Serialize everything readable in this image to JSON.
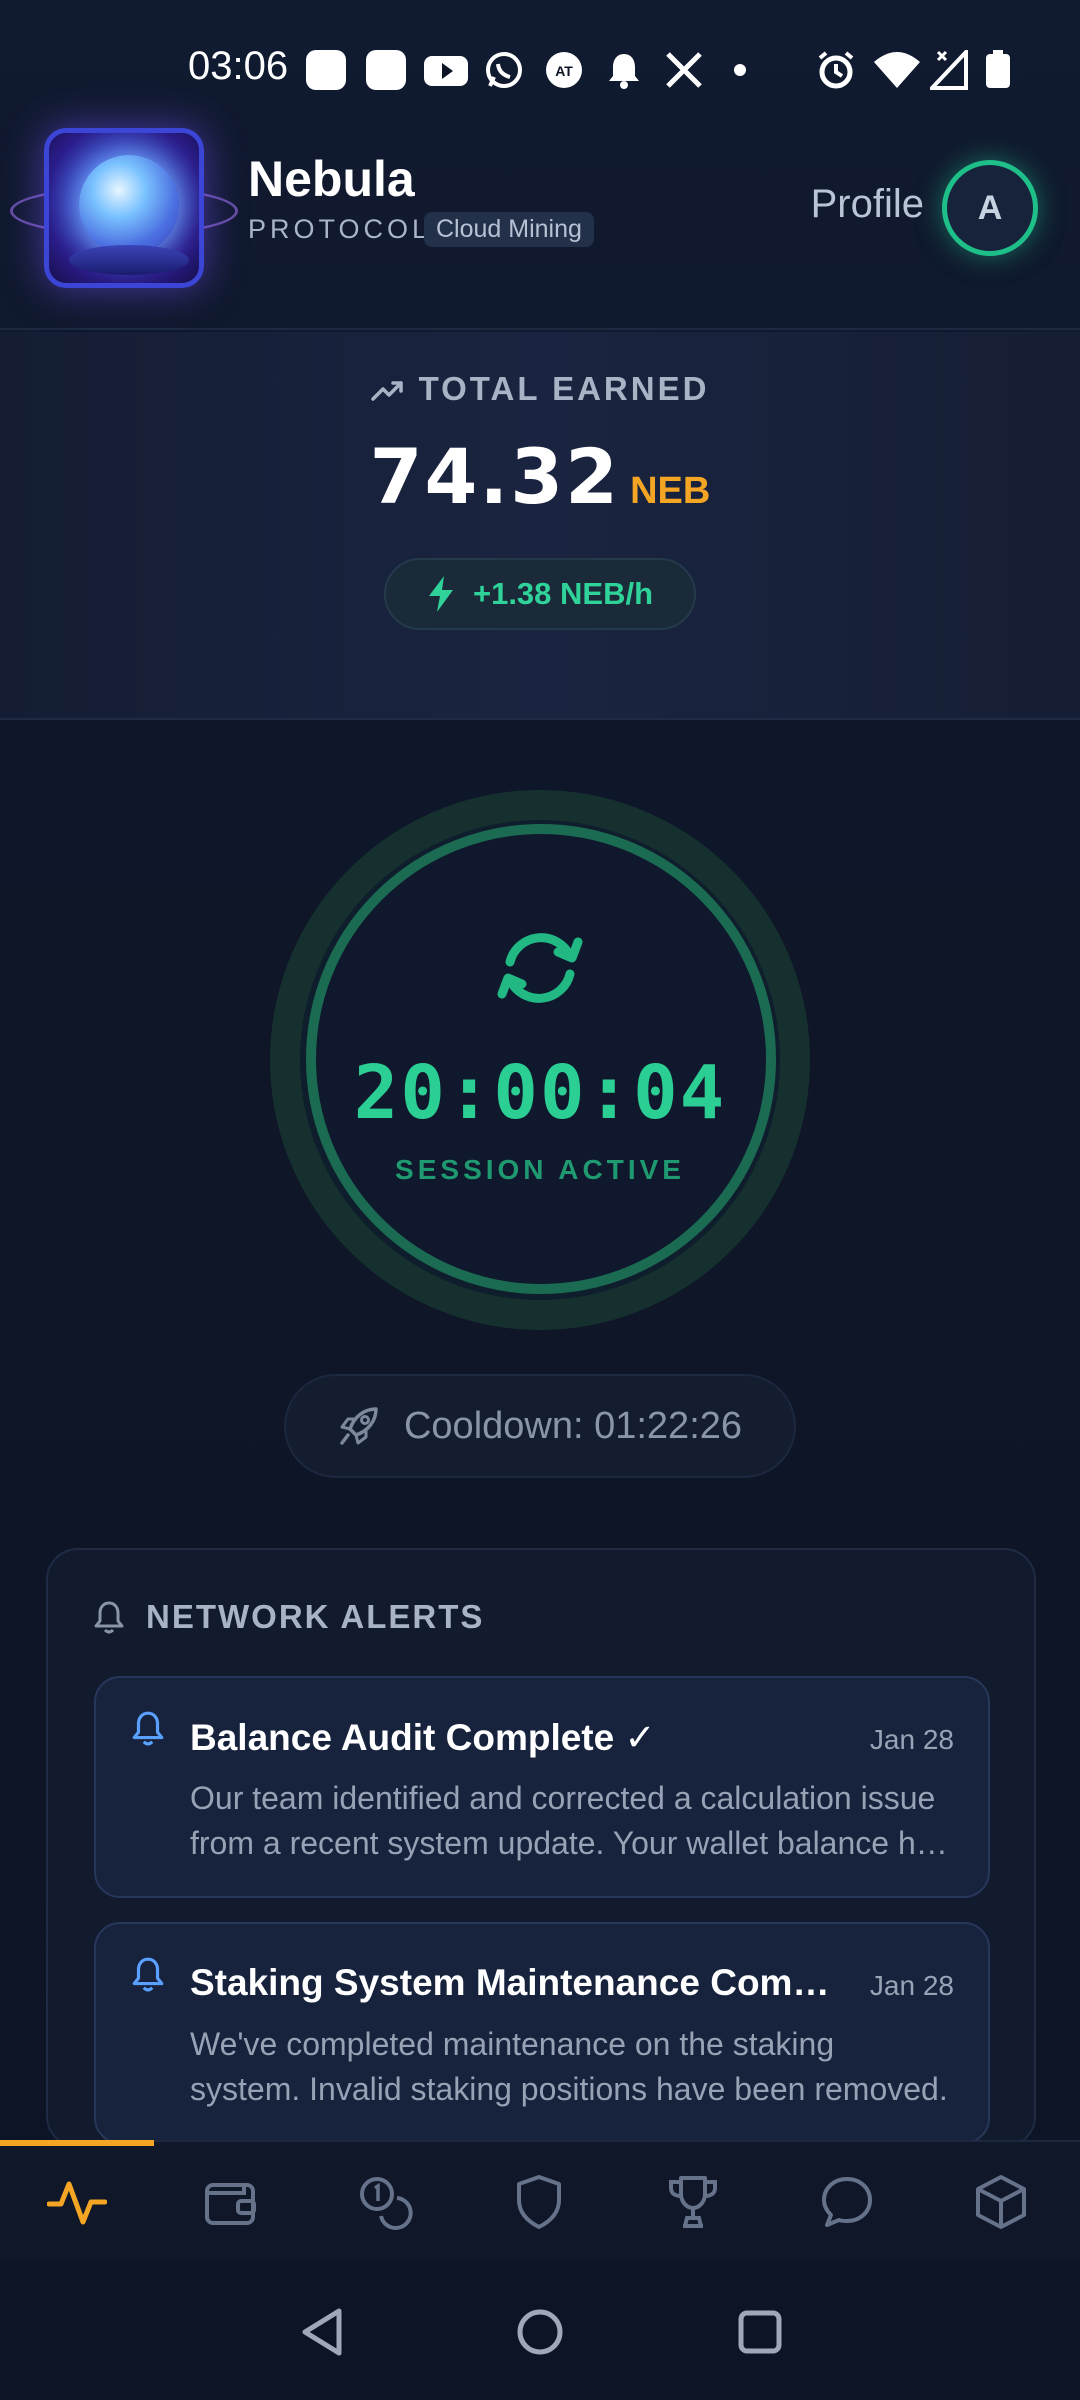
{
  "status_bar": {
    "time": "03:06",
    "icons": [
      "app-icon",
      "app-icon",
      "youtube-icon",
      "whatsapp-icon",
      "app-icon",
      "bell-icon",
      "x-icon",
      "dot-icon",
      "alarm-icon",
      "wifi-icon",
      "signal-icon",
      "battery-icon"
    ]
  },
  "header": {
    "brand_name": "Nebula",
    "brand_sub": "PROTOCOL",
    "brand_tag": "Cloud Mining",
    "profile_label": "Profile",
    "avatar_initial": "A"
  },
  "earned": {
    "title": "TOTAL EARNED",
    "value": "74.32",
    "unit": "NEB",
    "rate": "+1.38 NEB/h"
  },
  "session": {
    "time": "20:00:04",
    "label": "SESSION ACTIVE"
  },
  "cooldown": {
    "text": "Cooldown: 01:22:26"
  },
  "alerts": {
    "title": "NETWORK ALERTS",
    "items": [
      {
        "title": "Balance Audit Complete ✓",
        "date": "Jan 28",
        "body": "Our team identified and corrected a calculation issue from a recent system update. Your wallet balance has been restored."
      },
      {
        "title": "Staking System Maintenance Completed",
        "date": "Jan 28",
        "body": "We've completed maintenance on the staking system. Invalid staking positions have been removed."
      }
    ]
  },
  "bottom_nav": {
    "items": [
      "activity-icon",
      "wallet-icon",
      "coins-icon",
      "shield-icon",
      "trophy-icon",
      "chat-icon",
      "box-icon"
    ],
    "active": "activity-icon"
  },
  "colors": {
    "accent": "#f5a524",
    "success": "#2ccf93",
    "background": "#0d1426"
  }
}
